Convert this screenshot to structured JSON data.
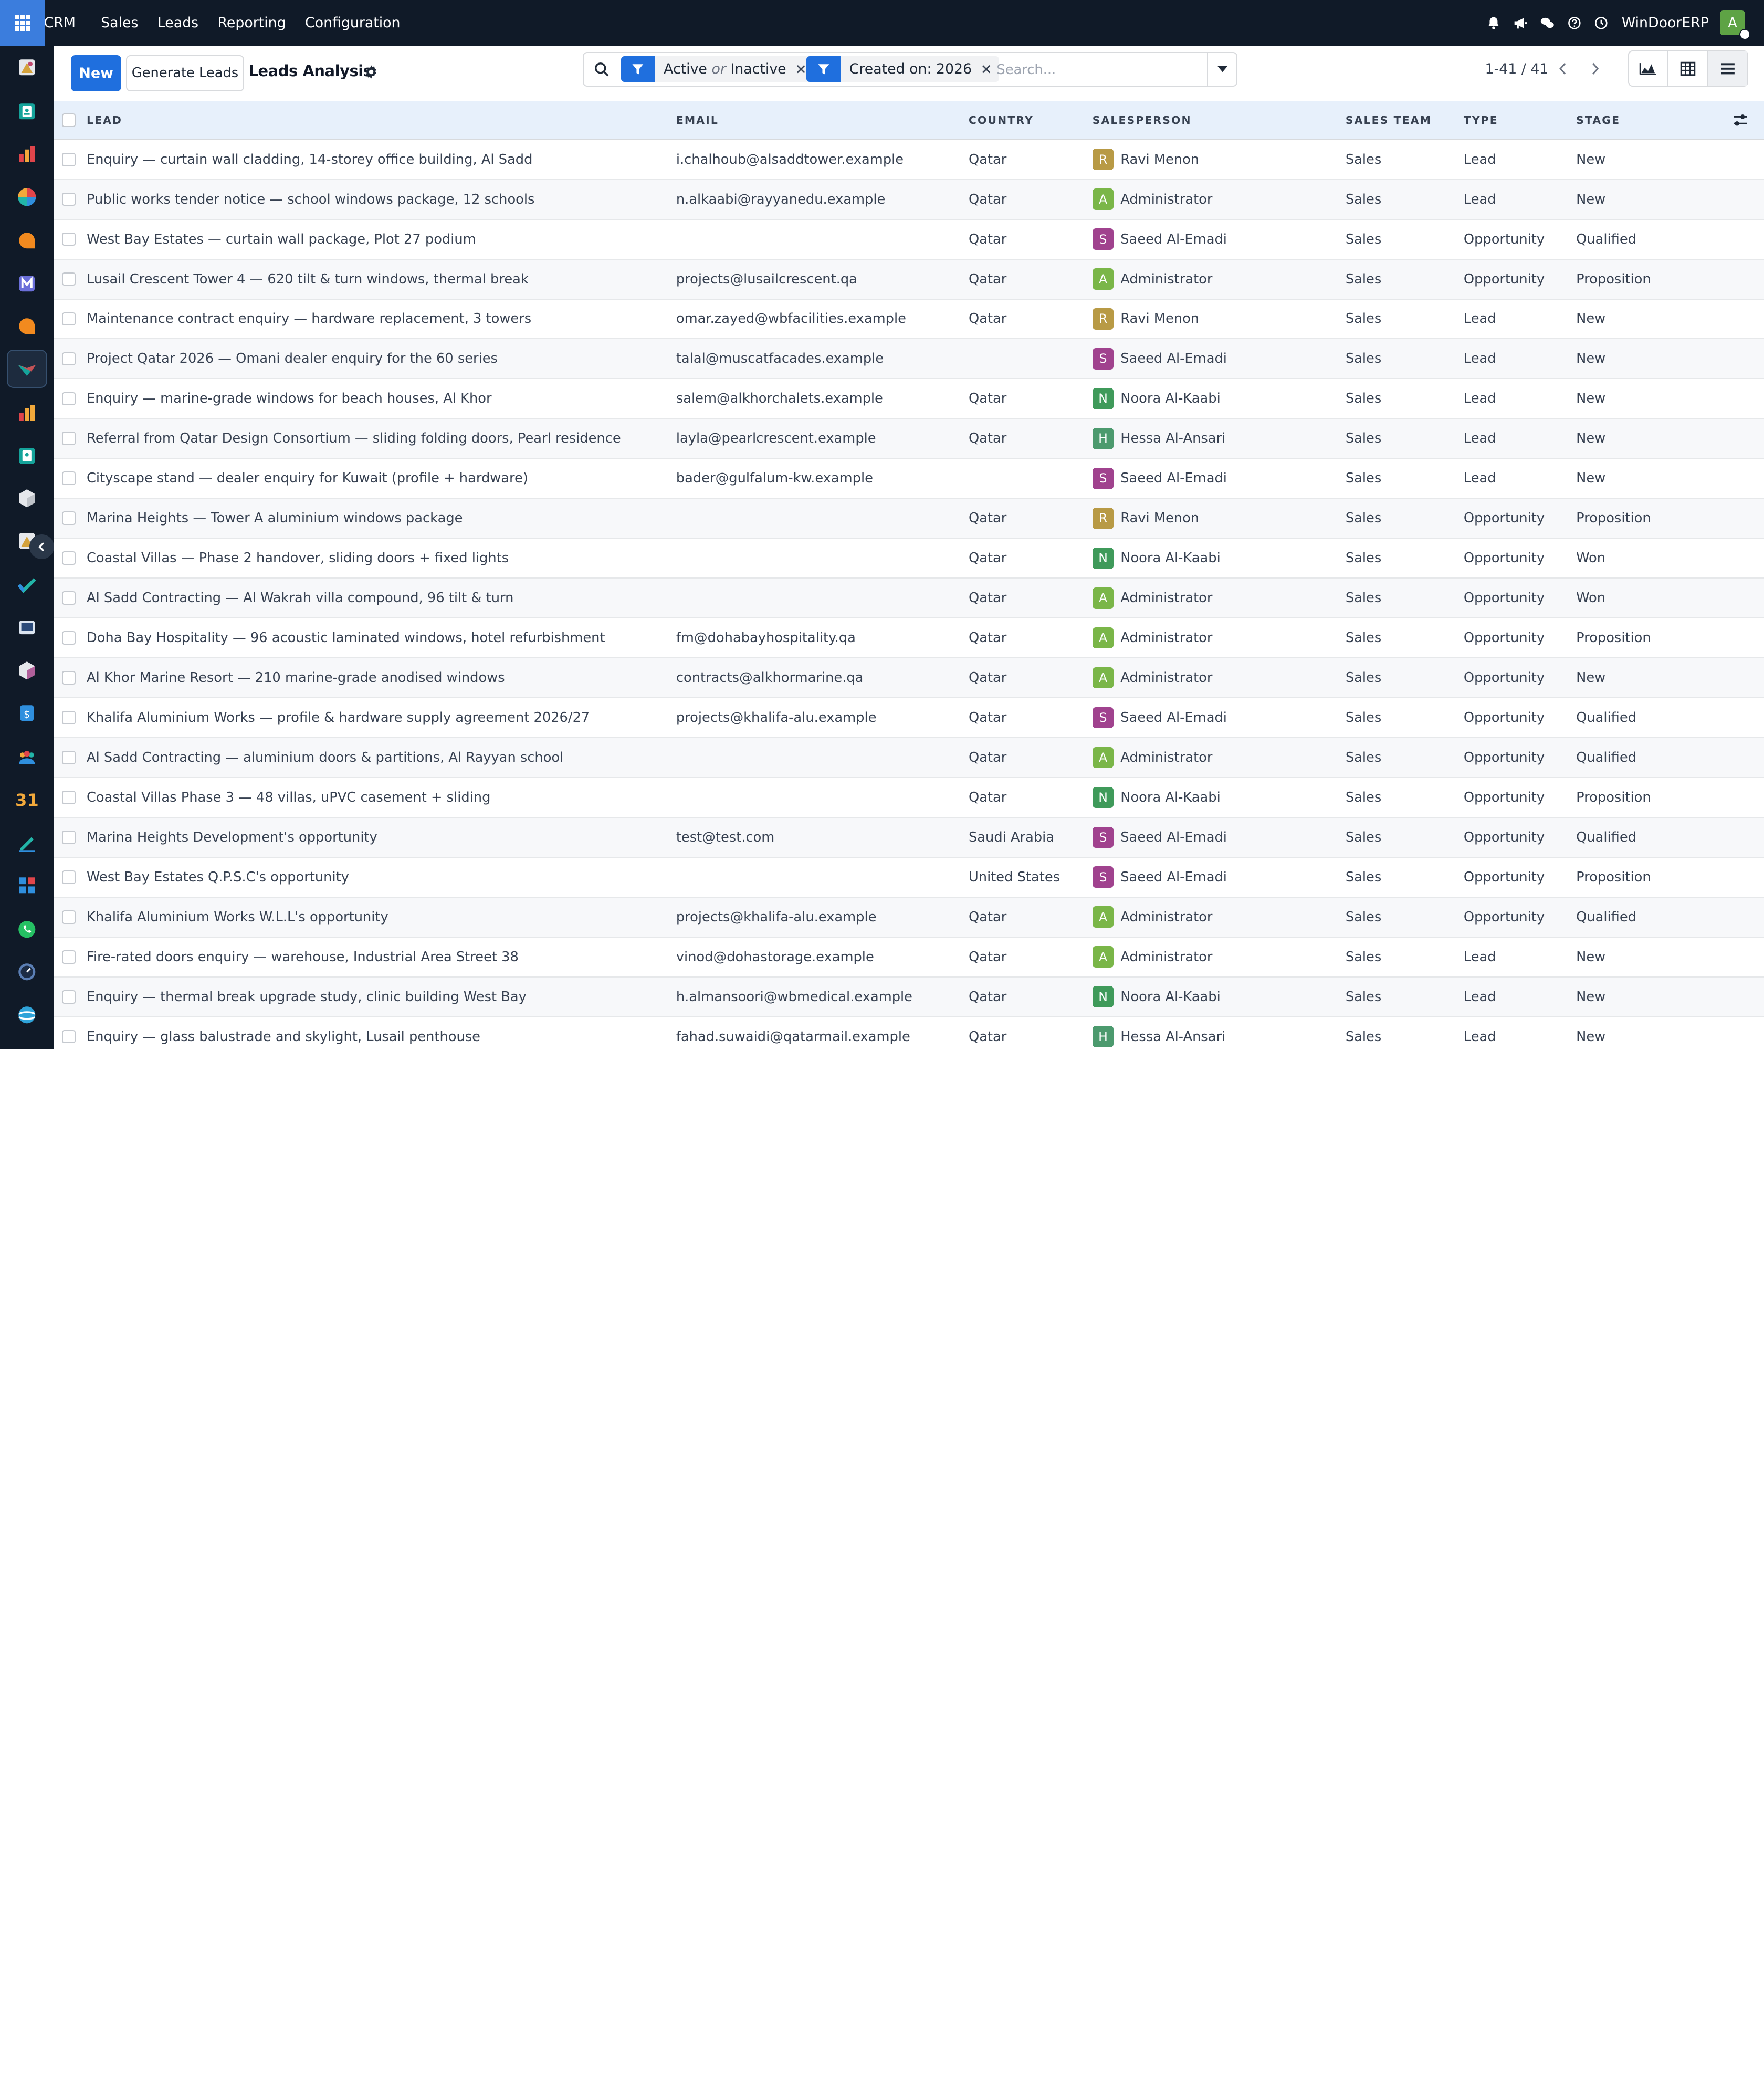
{
  "topbar": {
    "brand": "CRM",
    "menu": [
      "Sales",
      "Leads",
      "Reporting",
      "Configuration"
    ],
    "company": "WinDoorERP",
    "user_initial": "A"
  },
  "sidebar": {
    "icons": [
      "documents-app-icon",
      "contacts-app-icon",
      "reporting-app-icon",
      "discuss-app-icon",
      "chat-app-icon",
      "email-marketing-app-icon",
      "live-chat-app-icon",
      "crm-app-icon",
      "dashboards-app-icon",
      "employees-app-icon",
      "inventory-app-icon",
      "documents-app-icon-2",
      "project-app-icon",
      "knowledge-app-icon",
      "manufacturing-app-icon",
      "invoicing-app-icon",
      "team-app-icon",
      "calendar-app-icon",
      "sign-app-icon",
      "apps-catalog-icon",
      "whatsapp-app-icon",
      "timesheet-app-icon",
      "website-app-icon"
    ],
    "calendar_day": "31"
  },
  "control": {
    "new_label": "New",
    "generate_label": "Generate Leads",
    "title": "Leads Analysis",
    "facet1_a": "Active",
    "facet1_or": "or",
    "facet1_b": "Inactive",
    "facet2": "Created on: 2026",
    "search_placeholder": "Search...",
    "pager": "1-41 / 41"
  },
  "table": {
    "headers": [
      "LEAD",
      "EMAIL",
      "COUNTRY",
      "SALESPERSON",
      "SALES TEAM",
      "TYPE",
      "STAGE"
    ],
    "rows": [
      {
        "lead": "Enquiry — curtain wall cladding, 14-storey office building, Al Sadd",
        "email": "i.chalhoub@alsaddtower.example",
        "country": "Qatar",
        "sp_initial": "R",
        "sp_color": "#b89a45",
        "salesperson": "Ravi Menon",
        "team": "Sales",
        "type": "Lead",
        "stage": "New"
      },
      {
        "lead": "Public works tender notice — school windows package, 12 schools",
        "email": "n.alkaabi@rayyanedu.example",
        "country": "Qatar",
        "sp_initial": "A",
        "sp_color": "#7ab648",
        "salesperson": "Administrator",
        "team": "Sales",
        "type": "Lead",
        "stage": "New"
      },
      {
        "lead": "West Bay Estates — curtain wall package, Plot 27 podium",
        "email": "",
        "country": "Qatar",
        "sp_initial": "S",
        "sp_color": "#a0428e",
        "salesperson": "Saeed Al-Emadi",
        "team": "Sales",
        "type": "Opportunity",
        "stage": "Qualified"
      },
      {
        "lead": "Lusail Crescent Tower 4 — 620 tilt & turn windows, thermal break",
        "email": "projects@lusailcrescent.qa",
        "country": "Qatar",
        "sp_initial": "A",
        "sp_color": "#7ab648",
        "salesperson": "Administrator",
        "team": "Sales",
        "type": "Opportunity",
        "stage": "Proposition"
      },
      {
        "lead": "Maintenance contract enquiry — hardware replacement, 3 towers",
        "email": "omar.zayed@wbfacilities.example",
        "country": "Qatar",
        "sp_initial": "R",
        "sp_color": "#b89a45",
        "salesperson": "Ravi Menon",
        "team": "Sales",
        "type": "Lead",
        "stage": "New"
      },
      {
        "lead": "Project Qatar 2026 — Omani dealer enquiry for the 60 series",
        "email": "talal@muscatfacades.example",
        "country": "",
        "sp_initial": "S",
        "sp_color": "#a0428e",
        "salesperson": "Saeed Al-Emadi",
        "team": "Sales",
        "type": "Lead",
        "stage": "New"
      },
      {
        "lead": "Enquiry — marine-grade windows for beach houses, Al Khor",
        "email": "salem@alkhorchalets.example",
        "country": "Qatar",
        "sp_initial": "N",
        "sp_color": "#3f9a5a",
        "salesperson": "Noora Al-Kaabi",
        "team": "Sales",
        "type": "Lead",
        "stage": "New"
      },
      {
        "lead": "Referral from Qatar Design Consortium — sliding folding doors, Pearl residence",
        "email": "layla@pearlcrescent.example",
        "country": "Qatar",
        "sp_initial": "H",
        "sp_color": "#4c9a6e",
        "salesperson": "Hessa Al-Ansari",
        "team": "Sales",
        "type": "Lead",
        "stage": "New"
      },
      {
        "lead": "Cityscape stand — dealer enquiry for Kuwait (profile + hardware)",
        "email": "bader@gulfalum-kw.example",
        "country": "",
        "sp_initial": "S",
        "sp_color": "#a0428e",
        "salesperson": "Saeed Al-Emadi",
        "team": "Sales",
        "type": "Lead",
        "stage": "New"
      },
      {
        "lead": "Marina Heights — Tower A aluminium windows package",
        "email": "",
        "country": "Qatar",
        "sp_initial": "R",
        "sp_color": "#b89a45",
        "salesperson": "Ravi Menon",
        "team": "Sales",
        "type": "Opportunity",
        "stage": "Proposition"
      },
      {
        "lead": "Coastal Villas — Phase 2 handover, sliding doors + fixed lights",
        "email": "",
        "country": "Qatar",
        "sp_initial": "N",
        "sp_color": "#3f9a5a",
        "salesperson": "Noora Al-Kaabi",
        "team": "Sales",
        "type": "Opportunity",
        "stage": "Won"
      },
      {
        "lead": "Al Sadd Contracting — Al Wakrah villa compound, 96 tilt & turn",
        "email": "",
        "country": "Qatar",
        "sp_initial": "A",
        "sp_color": "#7ab648",
        "salesperson": "Administrator",
        "team": "Sales",
        "type": "Opportunity",
        "stage": "Won"
      },
      {
        "lead": "Doha Bay Hospitality — 96 acoustic laminated windows, hotel refurbishment",
        "email": "fm@dohabayhospitality.qa",
        "country": "Qatar",
        "sp_initial": "A",
        "sp_color": "#7ab648",
        "salesperson": "Administrator",
        "team": "Sales",
        "type": "Opportunity",
        "stage": "Proposition"
      },
      {
        "lead": "Al Khor Marine Resort — 210 marine-grade anodised windows",
        "email": "contracts@alkhormarine.qa",
        "country": "Qatar",
        "sp_initial": "A",
        "sp_color": "#7ab648",
        "salesperson": "Administrator",
        "team": "Sales",
        "type": "Opportunity",
        "stage": "New"
      },
      {
        "lead": "Khalifa Aluminium Works — profile & hardware supply agreement 2026/27",
        "email": "projects@khalifa-alu.example",
        "country": "Qatar",
        "sp_initial": "S",
        "sp_color": "#a0428e",
        "salesperson": "Saeed Al-Emadi",
        "team": "Sales",
        "type": "Opportunity",
        "stage": "Qualified"
      },
      {
        "lead": "Al Sadd Contracting — aluminium doors & partitions, Al Rayyan school",
        "email": "",
        "country": "Qatar",
        "sp_initial": "A",
        "sp_color": "#7ab648",
        "salesperson": "Administrator",
        "team": "Sales",
        "type": "Opportunity",
        "stage": "Qualified"
      },
      {
        "lead": "Coastal Villas Phase 3 — 48 villas, uPVC casement + sliding",
        "email": "",
        "country": "Qatar",
        "sp_initial": "N",
        "sp_color": "#3f9a5a",
        "salesperson": "Noora Al-Kaabi",
        "team": "Sales",
        "type": "Opportunity",
        "stage": "Proposition"
      },
      {
        "lead": "Marina Heights Development's opportunity",
        "email": "test@test.com",
        "country": "Saudi Arabia",
        "sp_initial": "S",
        "sp_color": "#a0428e",
        "salesperson": "Saeed Al-Emadi",
        "team": "Sales",
        "type": "Opportunity",
        "stage": "Qualified"
      },
      {
        "lead": "West Bay Estates Q.P.S.C's opportunity",
        "email": "",
        "country": "United States",
        "sp_initial": "S",
        "sp_color": "#a0428e",
        "salesperson": "Saeed Al-Emadi",
        "team": "Sales",
        "type": "Opportunity",
        "stage": "Proposition"
      },
      {
        "lead": "Khalifa Aluminium Works W.L.L's opportunity",
        "email": "projects@khalifa-alu.example",
        "country": "Qatar",
        "sp_initial": "A",
        "sp_color": "#7ab648",
        "salesperson": "Administrator",
        "team": "Sales",
        "type": "Opportunity",
        "stage": "Qualified"
      },
      {
        "lead": "Fire-rated doors enquiry — warehouse, Industrial Area Street 38",
        "email": "vinod@dohastorage.example",
        "country": "Qatar",
        "sp_initial": "A",
        "sp_color": "#7ab648",
        "salesperson": "Administrator",
        "team": "Sales",
        "type": "Lead",
        "stage": "New"
      },
      {
        "lead": "Enquiry — thermal break upgrade study, clinic building West Bay",
        "email": "h.almansoori@wbmedical.example",
        "country": "Qatar",
        "sp_initial": "N",
        "sp_color": "#3f9a5a",
        "salesperson": "Noora Al-Kaabi",
        "team": "Sales",
        "type": "Lead",
        "stage": "New"
      },
      {
        "lead": "Enquiry — glass balustrade and skylight, Lusail penthouse",
        "email": "fahad.suwaidi@qatarmail.example",
        "country": "Qatar",
        "sp_initial": "H",
        "sp_color": "#4c9a6e",
        "salesperson": "Hessa Al-Ansari",
        "team": "Sales",
        "type": "Lead",
        "stage": "New"
      }
    ]
  }
}
